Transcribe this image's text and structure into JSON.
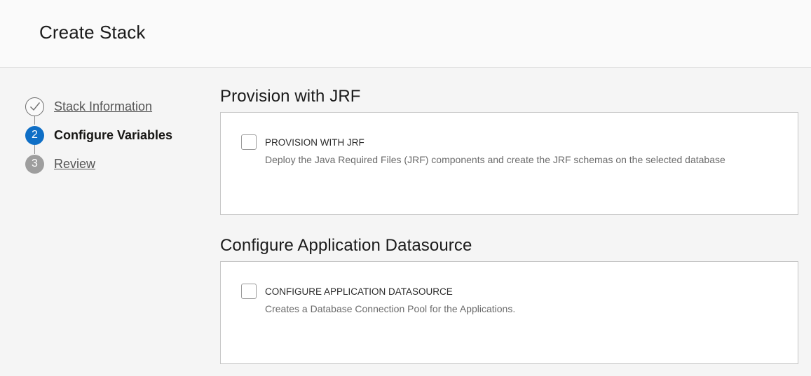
{
  "header": {
    "title": "Create Stack"
  },
  "steps": [
    {
      "number": "",
      "label": "Stack Information",
      "state": "done"
    },
    {
      "number": "2",
      "label": "Configure Variables",
      "state": "current"
    },
    {
      "number": "3",
      "label": "Review",
      "state": "pending"
    }
  ],
  "sections": [
    {
      "title": "Provision with JRF",
      "field_label": "PROVISION WITH JRF",
      "help": "Deploy the Java Required Files (JRF) components and create the JRF schemas on the selected database",
      "checked": false
    },
    {
      "title": "Configure Application Datasource",
      "field_label": "CONFIGURE APPLICATION DATASOURCE",
      "help": "Creates a Database Connection Pool for the Applications.",
      "checked": false
    }
  ],
  "colors": {
    "accent": "#0f6fc6",
    "pending": "#9e9e9e"
  },
  "icons": {
    "done_step": "checkmark-icon"
  }
}
